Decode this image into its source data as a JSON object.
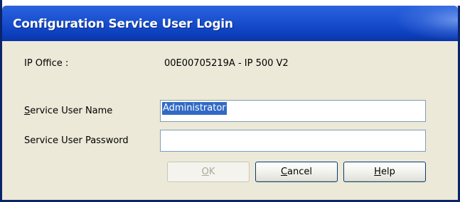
{
  "window": {
    "title": "Configuration Service User Login"
  },
  "ip_office": {
    "label": "IP Office :",
    "value": "00E00705219A - IP 500 V2"
  },
  "username": {
    "label_accel": "S",
    "label_rest": "ervice User Name",
    "value": "Administrator"
  },
  "password": {
    "label": "Service User Password",
    "value": ""
  },
  "buttons": {
    "ok": {
      "accel": "O",
      "rest": "K",
      "enabled": false
    },
    "cancel": {
      "accel": "C",
      "rest": "ancel"
    },
    "help": {
      "accel": "H",
      "rest": "elp"
    }
  },
  "colors": {
    "titlebar": "#1448c8",
    "dialog_bg": "#ece9d8",
    "selection": "#316ac5",
    "field_border": "#7f9db9"
  }
}
